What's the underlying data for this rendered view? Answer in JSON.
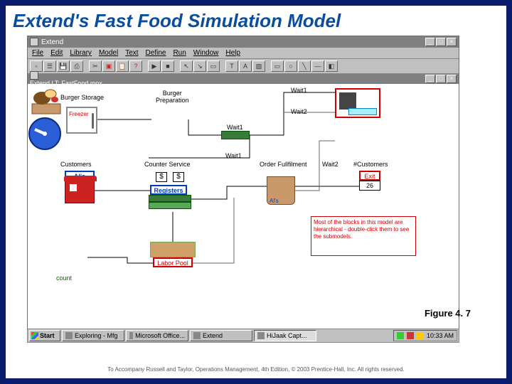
{
  "slide": {
    "title": "Extend's Fast Food Simulation Model",
    "figure": "Figure 4. 7"
  },
  "app": {
    "title": "Extend",
    "doc_title": "Extend LT: FastFood.mox",
    "menus": [
      "File",
      "Edit",
      "Library",
      "Model",
      "Text",
      "Define",
      "Run",
      "Window",
      "Help"
    ]
  },
  "labels": {
    "burger_storage": "Burger Storage",
    "burger_prep": "Burger\nPreparation",
    "freezer": "Freezer",
    "customers": "Customers",
    "counter_service": "Counter Service",
    "als": "Al's",
    "registers": "Registers",
    "count": "count",
    "labor_pool": "Labor Pool",
    "wait1": "Wait1",
    "wait1b": "Wait1",
    "wait2": "Wait2",
    "wait2b": "Wait2",
    "order_ff": "Order Fullfilment",
    "num_cust": "#Customers",
    "als2": "Al's",
    "exit": "Exit",
    "exit_count": "26",
    "note": "Most of the blocks in this model are hierarchical - double-click them to see the submodels.",
    "dollar": "$"
  },
  "taskbar": {
    "start": "Start",
    "items": [
      "Exploring - Mfg",
      "Microsoft Office...",
      "Extend",
      "HiJaak Capt..."
    ],
    "active": 3,
    "time": "10:33 AM"
  },
  "footer": "To Accompany Russell and Taylor, Operations Management, 4th Edition, © 2003 Prentice-Hall, Inc. All rights reserved."
}
